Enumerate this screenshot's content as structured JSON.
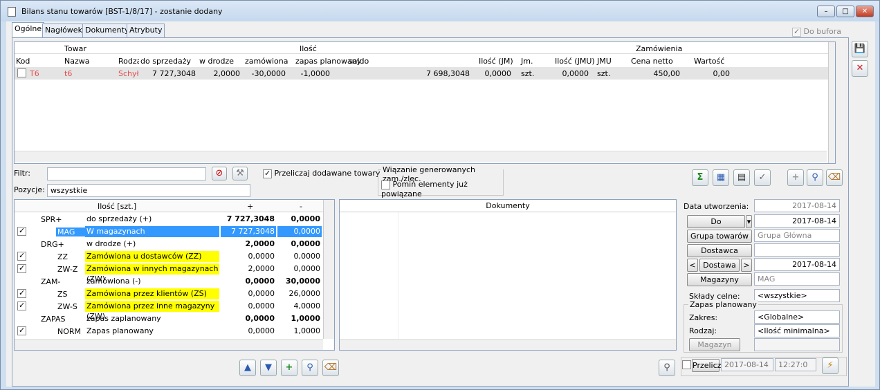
{
  "window": {
    "title": "Bilans stanu towarów [BST-1/8/17] - zostanie dodany"
  },
  "tabs": [
    "Ogólne",
    "Nagłówek",
    "Dokumenty",
    "Atrybuty"
  ],
  "do_bufora": "Do bufora",
  "grid": {
    "group_towar": "Towar",
    "group_ilosc": "Ilość",
    "group_zam": "Zamówienia",
    "cols": [
      "Kod",
      "Nazwa",
      "Rodza",
      "do sprzedaży",
      "w drodze",
      "zamówiona",
      "zapas planowany",
      "saldo",
      "Ilość (JM)",
      "Jm.",
      "Ilość (JMU)",
      "JMU",
      "Cena netto",
      "Wartość"
    ],
    "row": {
      "kod": "T6",
      "nazwa": "t6",
      "rodzaj": "Schył",
      "do_sprzedazy": "7 727,3048",
      "w_drodze": "2,0000",
      "zamowiona": "-30,0000",
      "zapas": "-1,0000",
      "saldo": "7 698,3048",
      "ilosc_jm": "0,0000",
      "jm": "szt.",
      "ilosc_jmu": "0,0000",
      "jmu": "szt.",
      "cena": "450,00",
      "wartosc": "0,00"
    }
  },
  "filter": {
    "label": "Filtr:",
    "value": "",
    "pozycje_label": "Pozycje:",
    "pozycje_value": "wszystkie"
  },
  "przeliczaj": "Przeliczaj dodawane towary",
  "wiazanie": {
    "title": "Wiązanie generowanych zam./zlec.",
    "pomin": "Pomiń elementy już powiązane"
  },
  "tree": {
    "header_name": "Ilość [szt.]",
    "header_plus": "+",
    "header_minus": "-",
    "rows": [
      {
        "code": "SPR+",
        "name": "do sprzedaży (+)",
        "plus": "7 727,3048",
        "minus": "0,0000",
        "bold": true
      },
      {
        "code": "MAG",
        "name": "W magazynach",
        "plus": "7 727,3048",
        "minus": "0,0000",
        "checked": true,
        "selected": true
      },
      {
        "code": "DRG+",
        "name": "w drodze (+)",
        "plus": "2,0000",
        "minus": "0,0000",
        "bold": true
      },
      {
        "code": "ZZ",
        "name": "Zamówiona u dostawców (ZZ)",
        "plus": "0,0000",
        "minus": "0,0000",
        "checked": true,
        "yellow": true
      },
      {
        "code": "ZW-Z",
        "name": "Zamówiona w innych magazynach (ZW)",
        "plus": "2,0000",
        "minus": "0,0000",
        "checked": true,
        "yellow": true
      },
      {
        "code": "ZAM-",
        "name": "zamówiona (-)",
        "plus": "0,0000",
        "minus": "30,0000",
        "bold": true
      },
      {
        "code": "ZS",
        "name": "Zamówiona przez klientów (ZS)",
        "plus": "0,0000",
        "minus": "26,0000",
        "checked": true,
        "yellow": true
      },
      {
        "code": "ZW-S",
        "name": "Zamówiona przez inne magazyny (ZW)",
        "plus": "0,0000",
        "minus": "4,0000",
        "checked": true,
        "yellow": true
      },
      {
        "code": "ZAPAS",
        "name": "zapas zaplanowany",
        "plus": "0,0000",
        "minus": "1,0000",
        "bold": true
      },
      {
        "code": "NORM",
        "name": "Zapas planowany",
        "plus": "0,0000",
        "minus": "1,0000",
        "checked": true
      }
    ]
  },
  "docs_header": "Dokumenty",
  "right": {
    "data_utworzenia_label": "Data utworzenia:",
    "data_utworzenia": "2017-08-14",
    "do_btn": "Do",
    "do_date": "2017-08-14",
    "grupa_btn": "Grupa towarów",
    "grupa_value": "Grupa Główna",
    "dostawca_btn": "Dostawca",
    "dostawca_value": "",
    "dostawa_btn": "Dostawa",
    "dostawa_date": "2017-08-14",
    "magazyny_btn": "Magazyny",
    "magazyny_value": "MAG",
    "sklady_label": "Składy celne:",
    "sklady_value": "<wszystkie>",
    "zapas_title": "Zapas planowany",
    "zakres_label": "Zakres:",
    "zakres_value": "<Globalne>",
    "rodzaj_label": "Rodzaj:",
    "rodzaj_value": "<Ilość minimalna>",
    "magazyn_btn": "Magazyn",
    "przelicz": "Przelicz",
    "przelicz_date": "2017-08-14",
    "przelicz_time": "12:27:0"
  }
}
